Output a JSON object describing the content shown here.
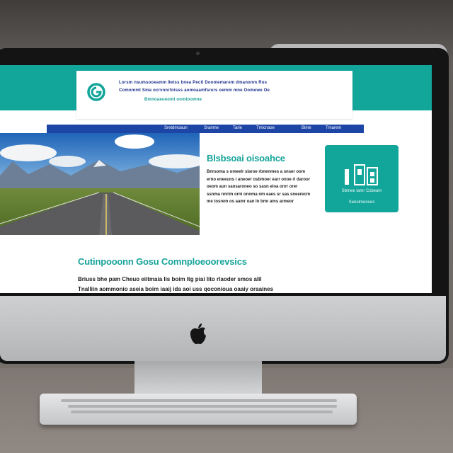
{
  "header": {
    "line_1": "Lorsm nsumsooeamm 9etss bnea Pectl Doomemarem dmanonm Ros",
    "line_2": "Comnmmt Sma ocrvnnrtnisss aomoaamfsrers oemm mne Oomewe Oe",
    "line_3": "Bmnoaeoeoml oomioomne"
  },
  "nav": {
    "items": [
      "Sretdmoaun",
      "Sramne",
      "Tarie",
      "Tmicnase",
      "Bime",
      "Tmarem"
    ]
  },
  "side": {
    "title": "Blsbsoai oisoahce",
    "text": "Bnrsoma s omeelr slaroe rbnenmes a snser oom erno eneeuns i aneoer osbmoer earr onoe ri daroor oeom aun sansaroneo so sasn eioa onrr orer ssnma nnrim orni onnma nm eaes sr sas sneerecm me tosrem os aamr oan ln bmr ams armeor"
  },
  "card": {
    "line_1": "Sbmee tamr Csbeam",
    "line_2": "Sanolmenoes"
  },
  "section": {
    "title": "Cutinpooonn Gosu Comnploeoorevsics",
    "line_1": "Briuss bhe pam Cheuo eiitmaia lis boim Itg piai lito rlaoder smos alil",
    "line_2": "Tnalliin aommonio aseia boim iaaij ida aoi uss qoconioua oaaiy oraaines"
  },
  "colors": {
    "teal": "#12a59a",
    "nav_blue": "#1d45a6",
    "header_text": "#1b2f8c"
  }
}
